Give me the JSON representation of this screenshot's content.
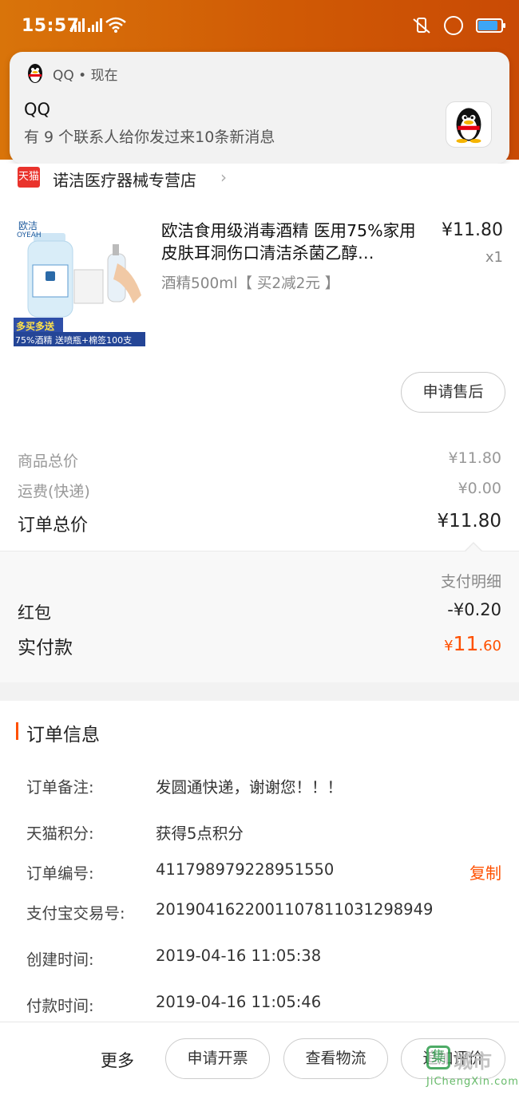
{
  "status_bar": {
    "time": "15:57"
  },
  "notification": {
    "app_name": "QQ • 现在",
    "title": "QQ",
    "text": "有 9 个联系人给你发过来10条新消息"
  },
  "store": {
    "badge": "天猫",
    "name": "诺洁医疗器械专营店",
    "chevron": "›"
  },
  "product": {
    "image_labels": {
      "brand": "欧洁",
      "brand_en": "OYEAH",
      "promo": "多买多送",
      "banner": "75%酒精 送喷瓶+棉签100支"
    },
    "title": "欧洁食用级消毒酒精 医用75%家用皮肤耳洞伤口清洁杀菌乙醇…",
    "sku": "酒精500ml【 买2减2元 】",
    "price": "¥11.80",
    "qty": "x1",
    "after_sale_label": "申请售后"
  },
  "summary": {
    "goods_total_label": "商品总价",
    "goods_total_value": "¥11.80",
    "shipping_label": "运费(快递)",
    "shipping_value": "¥0.00",
    "order_total_label": "订单总价",
    "order_total_value": "¥11.80"
  },
  "payment": {
    "detail_label": "支付明细",
    "redpacket_label": "红包",
    "redpacket_value": "-¥0.20",
    "paid_label": "实付款",
    "paid_currency": "¥",
    "paid_int": "11",
    "paid_dec": ".60"
  },
  "order_info": {
    "title": "订单信息",
    "rows": [
      {
        "label": "订单备注:",
        "value": "发圆通快递，谢谢您！！！"
      },
      {
        "label": "天猫积分:",
        "value": "获得5点积分"
      },
      {
        "label": "订单编号:",
        "value": "411798979228951550"
      },
      {
        "label": "支付宝交易号:",
        "value": "2019041622001107811031298949"
      },
      {
        "label": "创建时间:",
        "value": "2019-04-16 11:05:38"
      },
      {
        "label": "付款时间:",
        "value": "2019-04-16 11:05:46"
      }
    ],
    "copy_label": "复制"
  },
  "bottom_bar": {
    "more_label": "更多",
    "invoice_label": "申请开票",
    "logistics_label": "查看物流",
    "review_label": "追加评价"
  },
  "watermark": {
    "logo": "集",
    "text": "城市",
    "url": "JiChengXin.com"
  },
  "colors": {
    "accent": "#ff5000",
    "header": "#d05a05",
    "tmall_red": "#e9332c"
  }
}
